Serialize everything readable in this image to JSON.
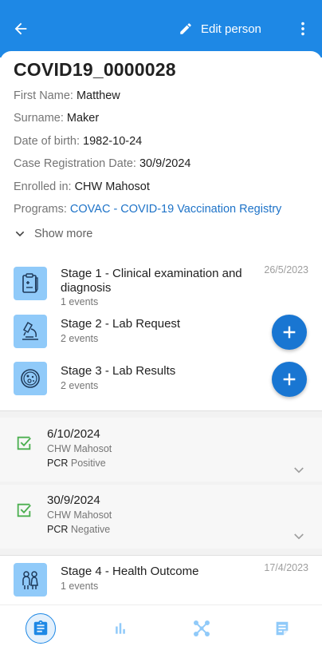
{
  "toolbar": {
    "back_icon": "arrow-back-icon",
    "edit_label": "Edit person",
    "edit_icon": "pencil-icon",
    "more_icon": "more-vert-icon"
  },
  "person": {
    "tei_id": "COVID19_0000028",
    "attributes": [
      {
        "label": "First Name:",
        "value": "Matthew"
      },
      {
        "label": "Surname:",
        "value": "Maker"
      },
      {
        "label": "Date of birth:",
        "value": "1982-10-24"
      },
      {
        "label": "Case Registration Date:",
        "value": "30/9/2024"
      },
      {
        "label": "Enrolled in:",
        "value": "CHW Mahosot"
      }
    ],
    "programs_label": "Programs:",
    "programs_value": "COVAC - COVID-19 Vaccination Registry",
    "show_more_label": "Show more"
  },
  "stages": [
    {
      "title": "Stage 1 - Clinical examination and diagnosis",
      "count": "1 events",
      "date": "26/5/2023",
      "icon": "clipboard-icon"
    },
    {
      "title": "Stage 2 - Lab Request",
      "count": "2 events",
      "icon": "microscope-icon"
    },
    {
      "title": "Stage 3 - Lab Results",
      "count": "2 events",
      "icon": "petri-dish-icon"
    },
    {
      "title": "Stage 4 - Health Outcome",
      "count": "1 events",
      "date": "17/4/2023",
      "icon": "people-icon"
    }
  ],
  "events": [
    {
      "date": "6/10/2024",
      "org": "CHW Mahosot",
      "data_label": "PCR",
      "data_value": "Positive"
    },
    {
      "date": "30/9/2024",
      "org": "CHW Mahosot",
      "data_label": "PCR",
      "data_value": "Negative"
    }
  ],
  "bottom_nav": {
    "items": [
      "dashboard-icon",
      "analytics-icon",
      "relationships-icon",
      "notes-icon"
    ],
    "active": "dashboard-icon"
  },
  "colors": {
    "primary": "#1e88e5",
    "fab": "#1976d2",
    "stage_icon_bg": "#90caf9",
    "check_green": "#4caf50",
    "link": "#1e73c8"
  }
}
